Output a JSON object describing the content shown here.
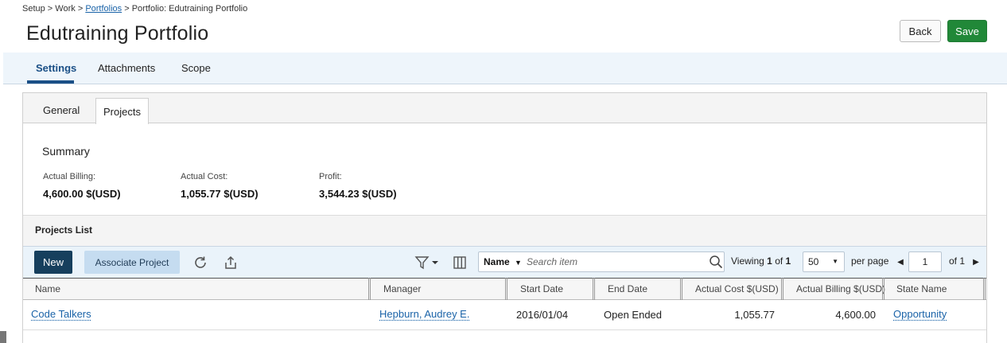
{
  "breadcrumb": {
    "setup": "Setup",
    "sep1": " > ",
    "work": "Work",
    "sep2": " > ",
    "portfolios": "Portfolios",
    "sep3": " > ",
    "current": "Portfolio: Edutraining Portfolio"
  },
  "page_title": "Edutraining Portfolio",
  "actions": {
    "back_label": "Back",
    "save_label": "Save"
  },
  "top_tabs": [
    {
      "label": "Settings",
      "active": true
    },
    {
      "label": "Attachments",
      "active": false
    },
    {
      "label": "Scope",
      "active": false
    }
  ],
  "sub_tabs": [
    {
      "label": "General",
      "active": false
    },
    {
      "label": "Projects",
      "active": true
    }
  ],
  "summary": {
    "title": "Summary",
    "actual_billing_label": "Actual Billing:",
    "actual_billing_value": "4,600.00 $(USD)",
    "actual_cost_label": "Actual Cost:",
    "actual_cost_value": "1,055.77 $(USD)",
    "profit_label": "Profit:",
    "profit_value": "3,544.23 $(USD)"
  },
  "projects_list": {
    "title": "Projects List",
    "new_label": "New",
    "associate_label": "Associate Project",
    "icons": [
      "refresh-icon",
      "export-icon",
      "filter-icon",
      "columns-icon",
      "search-icon"
    ],
    "search": {
      "field": "Name",
      "placeholder": "Search item"
    },
    "pagination": {
      "viewing_label": "Viewing",
      "viewing_current": "1",
      "of_label": "of",
      "viewing_total": "1",
      "per_page": "50",
      "per_page_label": "per page",
      "page": "1",
      "of_pages": "of 1"
    },
    "columns": [
      "Name",
      "Manager",
      "Start Date",
      "End Date",
      "Actual Cost $(USD)",
      "Actual Billing $(USD)",
      "State Name"
    ],
    "rows": [
      {
        "name": "Code Talkers",
        "manager": "Hepburn, Audrey E.",
        "start_date": "2016/01/04",
        "end_date": "Open Ended",
        "actual_cost": "1,055.77",
        "actual_billing": "4,600.00",
        "state": "Opportunity"
      }
    ]
  },
  "colors": {
    "save": "#218838",
    "new": "#163f5d",
    "associate": "#c5dcf0",
    "active_tab": "#1a4f86",
    "link": "#1a63a8"
  }
}
